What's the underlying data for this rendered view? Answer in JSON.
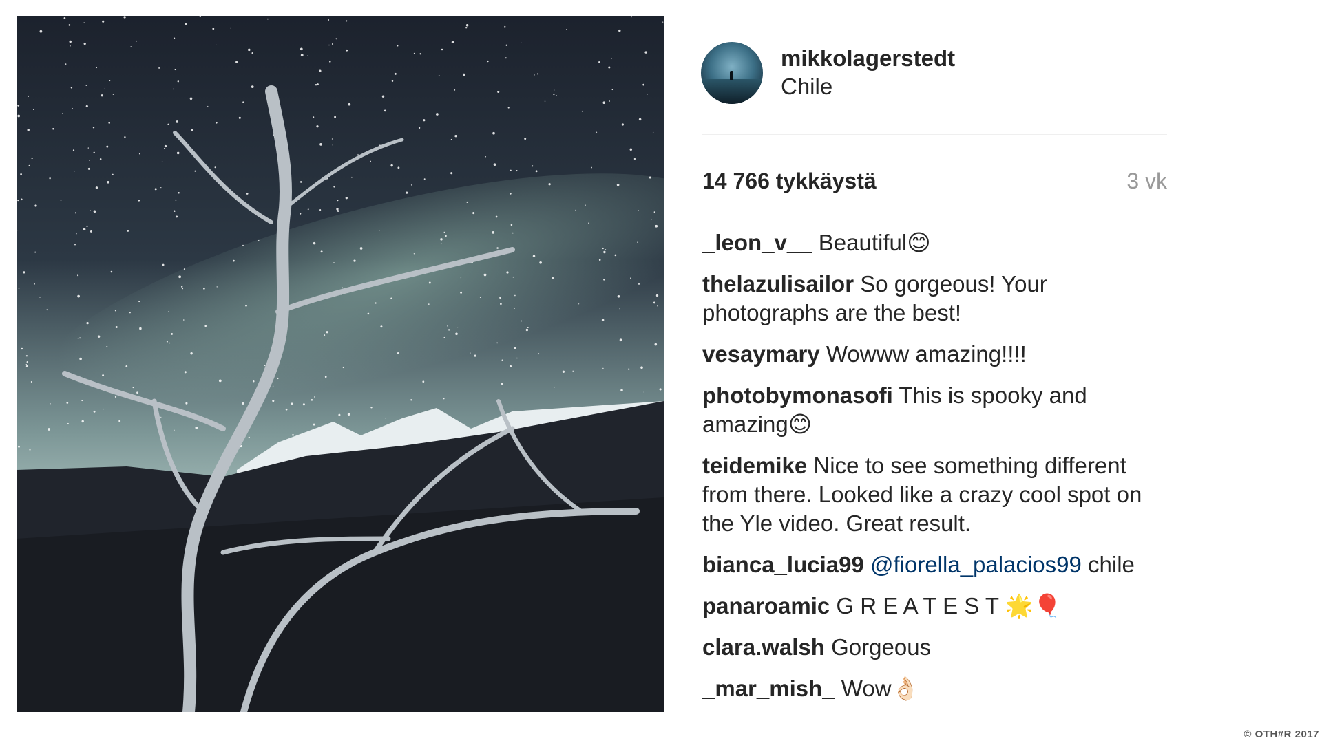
{
  "post": {
    "photo_icon": "starry-night-tree-photo",
    "author": {
      "username": "mikkolagerstedt",
      "location": "Chile",
      "avatar_icon": "avatar-photo"
    },
    "likes_text": "14 766 tykkäystä",
    "age_text": "3 vk",
    "comments": [
      {
        "user": "_leon_v__",
        "text": "Beautiful😊",
        "mention": "",
        "text_after": ""
      },
      {
        "user": "thelazulisailor",
        "text": "So gorgeous! Your photographs are the best!",
        "mention": "",
        "text_after": ""
      },
      {
        "user": "vesaymary",
        "text": "Wowww amazing!!!!",
        "mention": "",
        "text_after": ""
      },
      {
        "user": "photobymonasofi",
        "text": "This is spooky and amazing😊",
        "mention": "",
        "text_after": ""
      },
      {
        "user": "teidemike",
        "text": "Nice to see something different from there. Looked like a crazy cool spot on the Yle video. Great result.",
        "mention": "",
        "text_after": ""
      },
      {
        "user": "bianca_lucia99",
        "text": "",
        "mention": "@fiorella_palacios99",
        "text_after": "chile"
      },
      {
        "user": "panaroamic",
        "text": "G R E A T E S T 🌟🎈",
        "mention": "",
        "text_after": ""
      },
      {
        "user": "clara.walsh",
        "text": "Gorgeous",
        "mention": "",
        "text_after": ""
      },
      {
        "user": "_mar_mish_",
        "text": "Wow👌🏻",
        "mention": "",
        "text_after": ""
      }
    ]
  },
  "footer": {
    "copyright": "© OTH#R 2017"
  },
  "colors": {
    "text": "#262626",
    "muted": "#999999",
    "mention": "#003569",
    "divider": "#efefef"
  }
}
